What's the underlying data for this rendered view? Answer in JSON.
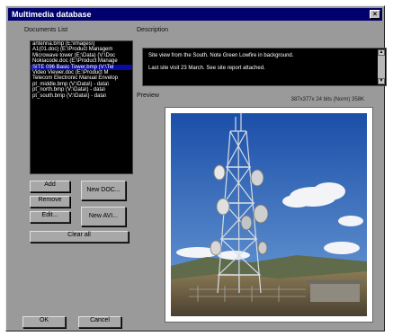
{
  "window": {
    "title": "Multimedia database",
    "close_glyph": "×"
  },
  "labels": {
    "documents_list": "Documents List",
    "description": "Description",
    "preview": "Preview"
  },
  "documents": [
    "antenna.bmp (E:\\Images\\)",
    "A1(01.doc) (E:\\Product Managem",
    "Microwave tower (E:\\Data) (V:\\Doc",
    "Nokiacode.doc (E:\\Product Manage",
    "SITE 096 Basic Tower.bmp (V:\\Tel",
    "Video Viewer.doc (E:\\Product M",
    "Telecom Electronic Manual Envelop",
    "pt_middle.bmp (V:\\Data\\) - data\\",
    "pt_north.bmp (V:\\Data\\) - data\\",
    "pt_south.bmp (V:\\Data\\) - data\\"
  ],
  "selected_index": 4,
  "buttons": {
    "add": "Add",
    "remove": "Remove",
    "edit": "Edit...",
    "new_doc": "New DOC...",
    "new_avi": "New AVI...",
    "clear_all": "Clear all",
    "ok": "OK",
    "cancel": "Cancel"
  },
  "description": {
    "line1": "Site view from the South.  Note Green Lowfire in background.",
    "line2": "Last site visit 23 March.  See site report attached."
  },
  "image_info": "387x377x 24 bits (Norm) 358K",
  "colors": {
    "titlebar": "#00006e",
    "selection": "#0a0aa8",
    "dialog": "#9a9a9a"
  }
}
